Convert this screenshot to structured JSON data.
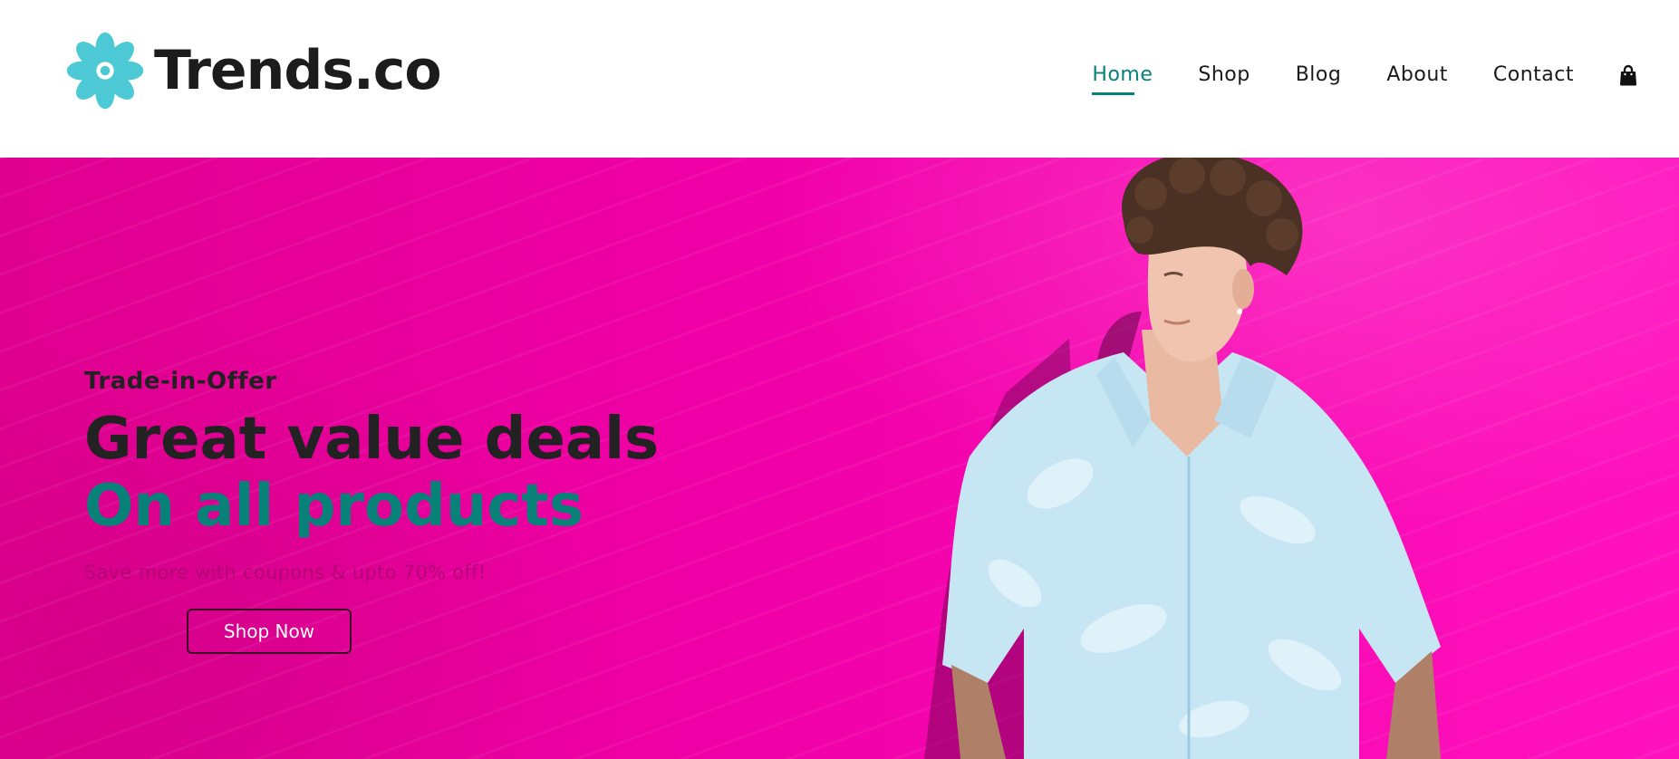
{
  "brand": {
    "name": "Trends.co",
    "logo_icon": "flower-icon",
    "logo_color": "#4cc9d4"
  },
  "nav": {
    "items": [
      {
        "label": "Home",
        "active": true
      },
      {
        "label": "Shop",
        "active": false
      },
      {
        "label": "Blog",
        "active": false
      },
      {
        "label": "About",
        "active": false
      },
      {
        "label": "Contact",
        "active": false
      }
    ],
    "cart_icon": "shopping-bag-icon",
    "active_color": "#088178"
  },
  "hero": {
    "eyebrow": "Trade-in-Offer",
    "headline_line1": "Great value deals",
    "headline_line2": "On all products",
    "subtext": "Save more with coupons & upto 70% off!",
    "button_label": "Shop Now",
    "background_color": "#f000a8",
    "accent_color": "#088178",
    "image": "young man with curly hair in light blue floral shirt against pink wall"
  }
}
